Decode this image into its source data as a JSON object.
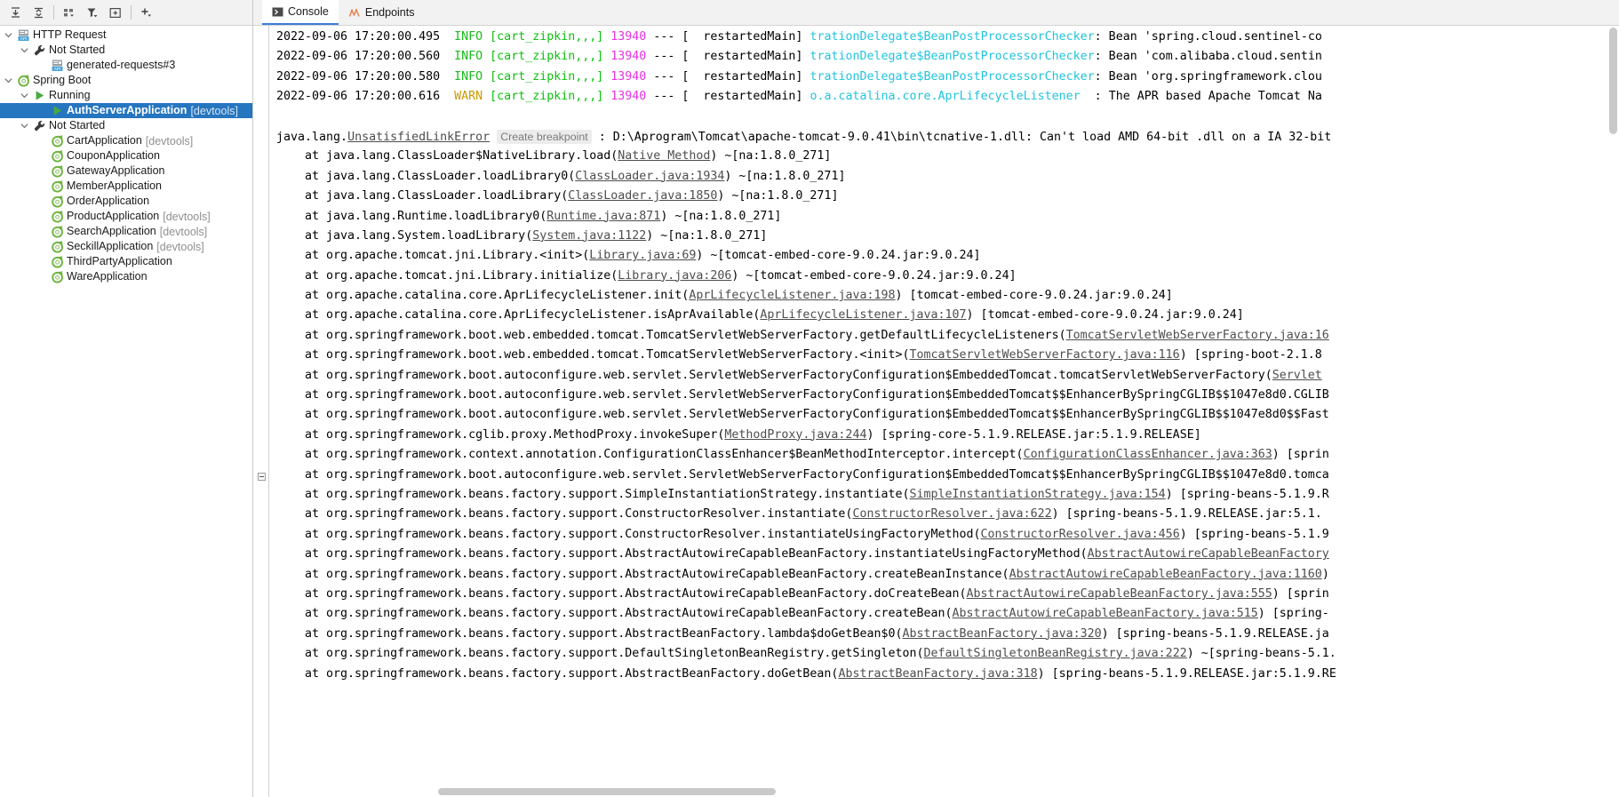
{
  "left_panel": {
    "toolbar": [
      {
        "name": "expand-all-button",
        "title": "Expand All"
      },
      {
        "name": "collapse-all-button",
        "title": "Collapse All"
      },
      {
        "name": "group-by-button",
        "title": "Group By"
      },
      {
        "name": "filter-button",
        "title": "Filter"
      },
      {
        "name": "show-toolwindow-button",
        "title": "Show Tool Window"
      },
      {
        "name": "add-configuration-button",
        "title": "Add"
      }
    ],
    "tree": [
      {
        "indent": 0,
        "arrow": "down",
        "icon": "http-request-icon",
        "label": "HTTP Request",
        "suffix": "",
        "bold": false,
        "selected": false
      },
      {
        "indent": 1,
        "arrow": "down",
        "icon": "wrench-icon",
        "label": "Not Started",
        "suffix": "",
        "bold": false,
        "selected": false
      },
      {
        "indent": 2,
        "arrow": "none",
        "icon": "http-request-icon",
        "label": "generated-requests#3",
        "suffix": "",
        "bold": false,
        "selected": false
      },
      {
        "indent": 0,
        "arrow": "down",
        "icon": "spring-boot-icon",
        "label": "Spring Boot",
        "suffix": "",
        "bold": false,
        "selected": false
      },
      {
        "indent": 1,
        "arrow": "down",
        "icon": "run-icon",
        "label": "Running",
        "suffix": "",
        "bold": false,
        "selected": false
      },
      {
        "indent": 2,
        "arrow": "none",
        "icon": "run-icon",
        "label": "AuthServerApplication",
        "suffix": "[devtools]",
        "bold": true,
        "selected": true
      },
      {
        "indent": 1,
        "arrow": "down",
        "icon": "wrench-icon",
        "label": "Not Started",
        "suffix": "",
        "bold": false,
        "selected": false
      },
      {
        "indent": 2,
        "arrow": "none",
        "icon": "spring-boot-icon",
        "label": "CartApplication",
        "suffix": "[devtools]",
        "bold": false,
        "selected": false
      },
      {
        "indent": 2,
        "arrow": "none",
        "icon": "spring-boot-icon",
        "label": "CouponApplication",
        "suffix": "",
        "bold": false,
        "selected": false
      },
      {
        "indent": 2,
        "arrow": "none",
        "icon": "spring-boot-icon",
        "label": "GatewayApplication",
        "suffix": "",
        "bold": false,
        "selected": false
      },
      {
        "indent": 2,
        "arrow": "none",
        "icon": "spring-boot-icon",
        "label": "MemberApplication",
        "suffix": "",
        "bold": false,
        "selected": false
      },
      {
        "indent": 2,
        "arrow": "none",
        "icon": "spring-boot-icon",
        "label": "OrderApplication",
        "suffix": "",
        "bold": false,
        "selected": false
      },
      {
        "indent": 2,
        "arrow": "none",
        "icon": "spring-boot-icon",
        "label": "ProductApplication",
        "suffix": "[devtools]",
        "bold": false,
        "selected": false
      },
      {
        "indent": 2,
        "arrow": "none",
        "icon": "spring-boot-icon",
        "label": "SearchApplication",
        "suffix": "[devtools]",
        "bold": false,
        "selected": false
      },
      {
        "indent": 2,
        "arrow": "none",
        "icon": "spring-boot-icon",
        "label": "SeckillApplication",
        "suffix": "[devtools]",
        "bold": false,
        "selected": false
      },
      {
        "indent": 2,
        "arrow": "none",
        "icon": "spring-boot-icon",
        "label": "ThirdPartyApplication",
        "suffix": "",
        "bold": false,
        "selected": false
      },
      {
        "indent": 2,
        "arrow": "none",
        "icon": "spring-boot-icon",
        "label": "WareApplication",
        "suffix": "",
        "bold": false,
        "selected": false
      }
    ]
  },
  "tabs": [
    {
      "label": "Console",
      "icon": "console-icon",
      "active": true
    },
    {
      "label": "Endpoints",
      "icon": "endpoints-icon",
      "active": false
    }
  ],
  "colors": {
    "selection": "#2675bf",
    "info": "#19ba19",
    "warn": "#cc9900",
    "context": "#0fbf0f",
    "pid": "#e832e8",
    "logger": "#22c3dd",
    "link": "#4d4d4d"
  },
  "console": {
    "log_lines": [
      {
        "ts": "2022-09-06 17:20:00.495",
        "level": "INFO",
        "ctx": "[cart_zipkin,,,]",
        "pid": "13940",
        "dash": "---",
        "thread": "[  restartedMain]",
        "logger": "trationDelegate$BeanPostProcessorChecker",
        "msg": ": Bean 'spring.cloud.sentinel-co"
      },
      {
        "ts": "2022-09-06 17:20:00.560",
        "level": "INFO",
        "ctx": "[cart_zipkin,,,]",
        "pid": "13940",
        "dash": "---",
        "thread": "[  restartedMain]",
        "logger": "trationDelegate$BeanPostProcessorChecker",
        "msg": ": Bean 'com.alibaba.cloud.sentin"
      },
      {
        "ts": "2022-09-06 17:20:00.580",
        "level": "INFO",
        "ctx": "[cart_zipkin,,,]",
        "pid": "13940",
        "dash": "---",
        "thread": "[  restartedMain]",
        "logger": "trationDelegate$BeanPostProcessorChecker",
        "msg": ": Bean 'org.springframework.clou"
      },
      {
        "ts": "2022-09-06 17:20:00.616",
        "level": "WARN",
        "ctx": "[cart_zipkin,,,]",
        "pid": "13940",
        "dash": "---",
        "thread": "[  restartedMain]",
        "logger": "o.a.catalina.core.AprLifecycleListener",
        "msg": "  : The APR based Apache Tomcat Na"
      }
    ],
    "exception": {
      "prefix": "java.lang.",
      "type": "UnsatisfiedLinkError",
      "breakpoint_label": "Create breakpoint",
      "message": " : D:\\Aprogram\\Tomcat\\apache-tomcat-9.0.41\\bin\\tcnative-1.dll: Can't load AMD 64-bit .dll on a IA 32-bit"
    },
    "stack": [
      {
        "pre": "    at java.lang.ClassLoader$NativeLibrary.load(",
        "link": "Native Method",
        "post": ") ~[na:1.8.0_271]"
      },
      {
        "pre": "    at java.lang.ClassLoader.loadLibrary0(",
        "link": "ClassLoader.java:1934",
        "post": ") ~[na:1.8.0_271]"
      },
      {
        "pre": "    at java.lang.ClassLoader.loadLibrary(",
        "link": "ClassLoader.java:1850",
        "post": ") ~[na:1.8.0_271]"
      },
      {
        "pre": "    at java.lang.Runtime.loadLibrary0(",
        "link": "Runtime.java:871",
        "post": ") ~[na:1.8.0_271]"
      },
      {
        "pre": "    at java.lang.System.loadLibrary(",
        "link": "System.java:1122",
        "post": ") ~[na:1.8.0_271]"
      },
      {
        "pre": "    at org.apache.tomcat.jni.Library.<init>(",
        "link": "Library.java:69",
        "post": ") ~[tomcat-embed-core-9.0.24.jar:9.0.24]"
      },
      {
        "pre": "    at org.apache.tomcat.jni.Library.initialize(",
        "link": "Library.java:206",
        "post": ") ~[tomcat-embed-core-9.0.24.jar:9.0.24]"
      },
      {
        "pre": "    at org.apache.catalina.core.AprLifecycleListener.init(",
        "link": "AprLifecycleListener.java:198",
        "post": ") [tomcat-embed-core-9.0.24.jar:9.0.24]"
      },
      {
        "pre": "    at org.apache.catalina.core.AprLifecycleListener.isAprAvailable(",
        "link": "AprLifecycleListener.java:107",
        "post": ") [tomcat-embed-core-9.0.24.jar:9.0.24]"
      },
      {
        "pre": "    at org.springframework.boot.web.embedded.tomcat.TomcatServletWebServerFactory.getDefaultLifecycleListeners(",
        "link": "TomcatServletWebServerFactory.java:16",
        "post": ""
      },
      {
        "pre": "    at org.springframework.boot.web.embedded.tomcat.TomcatServletWebServerFactory.<init>(",
        "link": "TomcatServletWebServerFactory.java:116",
        "post": ") [spring-boot-2.1.8"
      },
      {
        "pre": "    at org.springframework.boot.autoconfigure.web.servlet.ServletWebServerFactoryConfiguration$EmbeddedTomcat.tomcatServletWebServerFactory(",
        "link": "Servlet",
        "post": ""
      },
      {
        "pre": "    at org.springframework.boot.autoconfigure.web.servlet.ServletWebServerFactoryConfiguration$EmbeddedTomcat$$EnhancerBySpringCGLIB$$1047e8d0.CGLIB",
        "link": "",
        "post": ""
      },
      {
        "pre": "    at org.springframework.boot.autoconfigure.web.servlet.ServletWebServerFactoryConfiguration$EmbeddedTomcat$$EnhancerBySpringCGLIB$$1047e8d0$$Fast",
        "link": "",
        "post": ""
      },
      {
        "pre": "    at org.springframework.cglib.proxy.MethodProxy.invokeSuper(",
        "link": "MethodProxy.java:244",
        "post": ") [spring-core-5.1.9.RELEASE.jar:5.1.9.RELEASE]"
      },
      {
        "pre": "    at org.springframework.context.annotation.ConfigurationClassEnhancer$BeanMethodInterceptor.intercept(",
        "link": "ConfigurationClassEnhancer.java:363",
        "post": ") [sprin"
      },
      {
        "pre": "    at org.springframework.boot.autoconfigure.web.servlet.ServletWebServerFactoryConfiguration$EmbeddedTomcat$$EnhancerBySpringCGLIB$$1047e8d0.tomca",
        "link": "",
        "post": ""
      },
      {
        "pre": "    at org.springframework.beans.factory.support.SimpleInstantiationStrategy.instantiate(",
        "link": "SimpleInstantiationStrategy.java:154",
        "post": ") [spring-beans-5.1.9.R"
      },
      {
        "pre": "    at org.springframework.beans.factory.support.ConstructorResolver.instantiate(",
        "link": "ConstructorResolver.java:622",
        "post": ") [spring-beans-5.1.9.RELEASE.jar:5.1."
      },
      {
        "pre": "    at org.springframework.beans.factory.support.ConstructorResolver.instantiateUsingFactoryMethod(",
        "link": "ConstructorResolver.java:456",
        "post": ") [spring-beans-5.1.9"
      },
      {
        "pre": "    at org.springframework.beans.factory.support.AbstractAutowireCapableBeanFactory.instantiateUsingFactoryMethod(",
        "link": "AbstractAutowireCapableBeanFactory",
        "post": ""
      },
      {
        "pre": "    at org.springframework.beans.factory.support.AbstractAutowireCapableBeanFactory.createBeanInstance(",
        "link": "AbstractAutowireCapableBeanFactory.java:1160",
        "post": ")"
      },
      {
        "pre": "    at org.springframework.beans.factory.support.AbstractAutowireCapableBeanFactory.doCreateBean(",
        "link": "AbstractAutowireCapableBeanFactory.java:555",
        "post": ") [sprin"
      },
      {
        "pre": "    at org.springframework.beans.factory.support.AbstractAutowireCapableBeanFactory.createBean(",
        "link": "AbstractAutowireCapableBeanFactory.java:515",
        "post": ") [spring-"
      },
      {
        "pre": "    at org.springframework.beans.factory.support.AbstractBeanFactory.lambda$doGetBean$0(",
        "link": "AbstractBeanFactory.java:320",
        "post": ") [spring-beans-5.1.9.RELEASE.ja"
      },
      {
        "pre": "    at org.springframework.beans.factory.support.DefaultSingletonBeanRegistry.getSingleton(",
        "link": "DefaultSingletonBeanRegistry.java:222",
        "post": ") ~[spring-beans-5.1."
      },
      {
        "pre": "    at org.springframework.beans.factory.support.AbstractBeanFactory.doGetBean(",
        "link": "AbstractBeanFactory.java:318",
        "post": ") [spring-beans-5.1.9.RELEASE.jar:5.1.9.RE"
      }
    ]
  }
}
